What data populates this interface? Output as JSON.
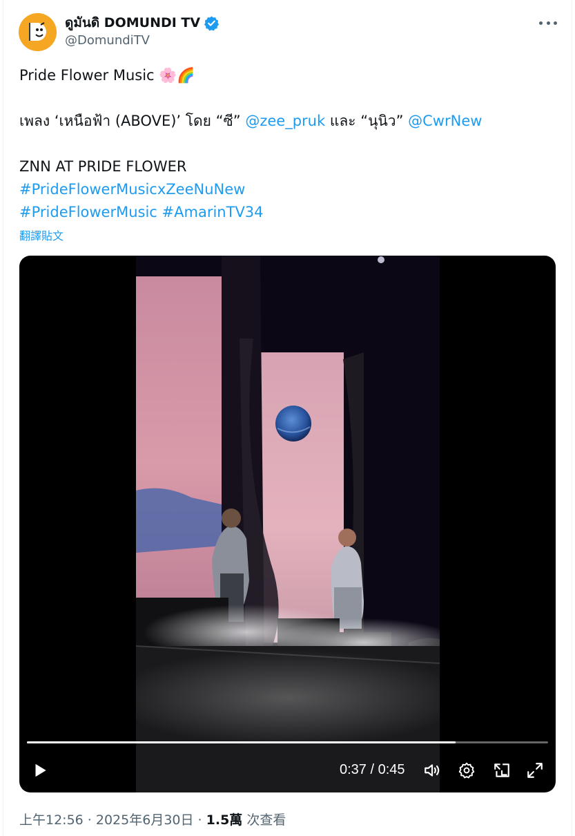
{
  "author": {
    "display_name": "ดูมันดิ DOMUNDI TV",
    "handle": "@DomundiTV",
    "verified": true,
    "avatar_bg": "#f5a623"
  },
  "tweet": {
    "line1_text": "Pride Flower Music ",
    "line1_emojis": "🌸🌈",
    "line2_prefix": "เพลง ‘เหนือฟ้า (ABOVE)’ โดย “ซี” ",
    "line2_mention1": "@zee_pruk",
    "line2_middle": " และ “นุนิว” ",
    "line2_mention2": "@CwrNew",
    "line3": "ZNN AT PRIDE FLOWER",
    "hashtag1": "#PrideFlowerMusicxZeeNuNew",
    "hashtag2": "#PrideFlowerMusic",
    "hashtag3": "#AmarinTV34",
    "translate_label": "翻譯貼文"
  },
  "video": {
    "current_time": "0:37",
    "total_time": "0:45",
    "time_display": "0:37 / 0:45",
    "progress_fraction": 0.822,
    "controls": [
      "play-icon",
      "volume-icon",
      "settings-icon",
      "pip-icon",
      "fullscreen-icon"
    ]
  },
  "meta": {
    "timestamp": "上午12:56 · 2025年6月30日 · ",
    "views_count": "1.5萬",
    "views_label": " 次查看"
  },
  "colors": {
    "link": "#1d9bf0",
    "secondary_text": "#536471",
    "verified_badge": "#1d9bf0"
  }
}
